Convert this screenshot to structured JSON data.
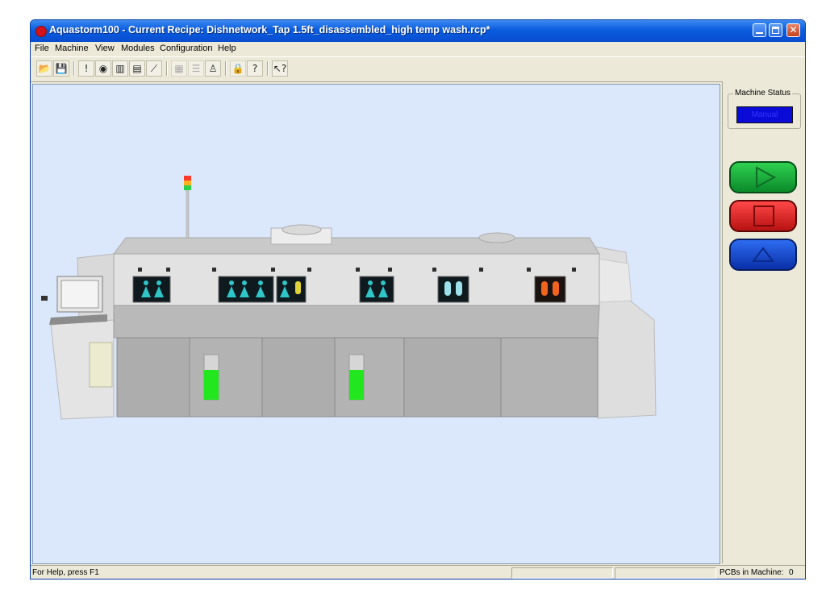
{
  "window": {
    "title": "Aquastorm100 - Current Recipe: Dishnetwork_Tap 1.5ft_disassembled_high temp wash.rcp*"
  },
  "menu": [
    "File",
    "Machine",
    "View",
    "Modules",
    "Configuration",
    "Help"
  ],
  "toolbar": {
    "buttons": [
      "open-icon",
      "save-icon",
      "info-icon",
      "globe-icon",
      "layout-icon",
      "calculator-icon",
      "graph-icon",
      "panel-disabled-icon",
      "list-disabled-icon",
      "person-icon",
      "lock-icon",
      "help-icon",
      "whats-this-icon"
    ]
  },
  "status_panel": {
    "label": "Machine Status",
    "value": "Manual"
  },
  "controls": {
    "run_color": "#1bb83c",
    "stop_color": "#e01e1e",
    "eject_color": "#1a4fd6"
  },
  "statusbar": {
    "help": "For Help, press F1",
    "pcbs_label": "PCBs in Machine:",
    "pcbs_value": "0"
  },
  "colors": {
    "title_bar": "#0a5ce0",
    "viewport": "#dbe8fb",
    "tank_level": "#22e61e",
    "status_value_bg": "#0b0bd8"
  }
}
